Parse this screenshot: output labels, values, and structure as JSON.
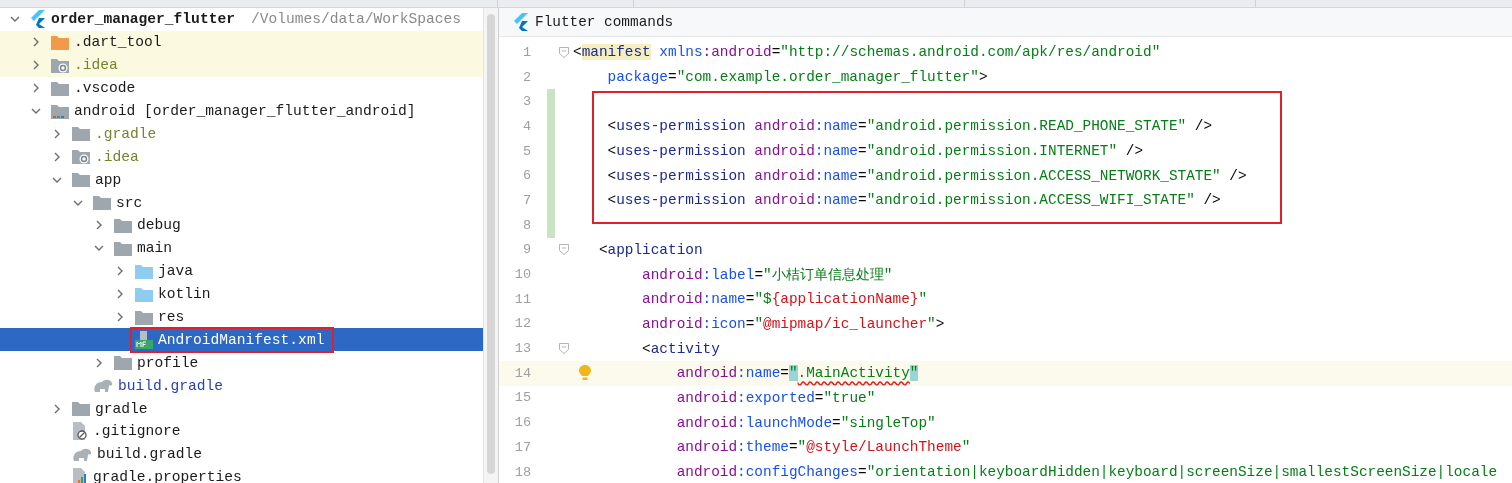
{
  "project_tree": {
    "items": [
      {
        "name": "order_manager_flutter",
        "detail": "/Volumes/data/WorkSpaces",
        "kind": "flutter",
        "expanded": true,
        "selected": false,
        "highlighted": false,
        "annotated": false,
        "ignored": false,
        "modified": false,
        "children": [
          {
            "name": ".dart_tool",
            "kind": "excluded-folder",
            "expanded": false,
            "selected": false,
            "highlighted": true,
            "annotated": false,
            "ignored": false,
            "modified": false
          },
          {
            "name": ".idea",
            "kind": "settings-folder",
            "expanded": false,
            "selected": false,
            "highlighted": true,
            "annotated": false,
            "ignored": true,
            "modified": false
          },
          {
            "name": ".vscode",
            "kind": "folder",
            "expanded": false,
            "selected": false,
            "highlighted": false,
            "annotated": false,
            "ignored": false,
            "modified": false
          },
          {
            "name": "android [order_manager_flutter_android]",
            "kind": "module",
            "expanded": true,
            "selected": false,
            "highlighted": false,
            "annotated": false,
            "ignored": false,
            "modified": false,
            "children": [
              {
                "name": ".gradle",
                "kind": "folder",
                "expanded": false,
                "selected": false,
                "highlighted": false,
                "annotated": false,
                "ignored": true,
                "modified": false
              },
              {
                "name": ".idea",
                "kind": "settings-folder",
                "expanded": false,
                "selected": false,
                "highlighted": false,
                "annotated": false,
                "ignored": true,
                "modified": false
              },
              {
                "name": "app",
                "kind": "folder",
                "expanded": true,
                "selected": false,
                "highlighted": false,
                "annotated": false,
                "ignored": false,
                "modified": false,
                "children": [
                  {
                    "name": "src",
                    "kind": "folder",
                    "expanded": true,
                    "selected": false,
                    "highlighted": false,
                    "annotated": false,
                    "ignored": false,
                    "modified": false,
                    "children": [
                      {
                        "name": "debug",
                        "kind": "folder",
                        "expanded": false,
                        "selected": false,
                        "highlighted": false,
                        "annotated": false,
                        "ignored": false,
                        "modified": false
                      },
                      {
                        "name": "main",
                        "kind": "folder",
                        "expanded": true,
                        "selected": false,
                        "highlighted": false,
                        "annotated": false,
                        "ignored": false,
                        "modified": false,
                        "children": [
                          {
                            "name": "java",
                            "kind": "source-folder",
                            "expanded": false,
                            "selected": false,
                            "highlighted": false,
                            "annotated": false,
                            "ignored": false,
                            "modified": false
                          },
                          {
                            "name": "kotlin",
                            "kind": "source-folder",
                            "expanded": false,
                            "selected": false,
                            "highlighted": false,
                            "annotated": false,
                            "ignored": false,
                            "modified": false
                          },
                          {
                            "name": "res",
                            "kind": "folder",
                            "expanded": false,
                            "selected": false,
                            "highlighted": false,
                            "annotated": false,
                            "ignored": false,
                            "modified": false
                          },
                          {
                            "name": "AndroidManifest.xml",
                            "kind": "manifest",
                            "selected": true,
                            "highlighted": false,
                            "annotated": true,
                            "ignored": false,
                            "modified": false
                          }
                        ]
                      },
                      {
                        "name": "profile",
                        "kind": "folder",
                        "expanded": false,
                        "selected": false,
                        "highlighted": false,
                        "annotated": false,
                        "ignored": false,
                        "modified": false
                      }
                    ]
                  },
                  {
                    "name": "build.gradle",
                    "kind": "gradle",
                    "selected": false,
                    "highlighted": false,
                    "annotated": false,
                    "ignored": false,
                    "modified": true
                  }
                ]
              },
              {
                "name": "gradle",
                "kind": "folder",
                "expanded": false,
                "selected": false,
                "highlighted": false,
                "annotated": false,
                "ignored": false,
                "modified": false
              },
              {
                "name": ".gitignore",
                "kind": "gitignore",
                "selected": false,
                "highlighted": false,
                "annotated": false,
                "ignored": false,
                "modified": false
              },
              {
                "name": "build.gradle",
                "kind": "gradle",
                "selected": false,
                "highlighted": false,
                "annotated": false,
                "ignored": false,
                "modified": false
              },
              {
                "name": "gradle.properties",
                "kind": "properties",
                "selected": false,
                "highlighted": false,
                "annotated": false,
                "ignored": false,
                "modified": false
              }
            ]
          }
        ]
      }
    ]
  },
  "editor": {
    "toolbar": {
      "label": "Flutter commands"
    },
    "lines": [
      {
        "number": "1",
        "changed": false,
        "fold": true,
        "current": false,
        "boxed": false,
        "bulb": false,
        "tokens": [
          {
            "kind": "punct",
            "text": "<"
          },
          {
            "kind": "tag-match",
            "text": "manifest"
          },
          {
            "kind": "attr",
            "text": " xmlns"
          },
          {
            "kind": "ns",
            "text": ":android"
          },
          {
            "kind": "punct",
            "text": "="
          },
          {
            "kind": "string",
            "text": "\"http://schemas.android.com/apk/res/android\""
          }
        ]
      },
      {
        "number": "2",
        "changed": false,
        "fold": false,
        "current": false,
        "boxed": false,
        "bulb": false,
        "tokens": [
          {
            "kind": "attr",
            "text": "    package"
          },
          {
            "kind": "punct",
            "text": "="
          },
          {
            "kind": "string",
            "text": "\"com.example.order_manager_flutter\""
          },
          {
            "kind": "punct",
            "text": ">"
          }
        ]
      },
      {
        "number": "3",
        "changed": true,
        "fold": false,
        "current": false,
        "boxed": true,
        "bulb": false
      },
      {
        "number": "4",
        "changed": true,
        "fold": false,
        "current": false,
        "boxed": true,
        "bulb": false,
        "tokens": [
          {
            "kind": "punct",
            "text": "    <"
          },
          {
            "kind": "tag",
            "text": "uses-permission"
          },
          {
            "kind": "ns",
            "text": " android"
          },
          {
            "kind": "attr",
            "text": ":name"
          },
          {
            "kind": "punct",
            "text": "="
          },
          {
            "kind": "string",
            "text": "\"android.permission.READ_PHONE_STATE\""
          },
          {
            "kind": "punct",
            "text": " />"
          }
        ]
      },
      {
        "number": "5",
        "changed": true,
        "fold": false,
        "current": false,
        "boxed": true,
        "bulb": false,
        "tokens": [
          {
            "kind": "punct",
            "text": "    <"
          },
          {
            "kind": "tag",
            "text": "uses-permission"
          },
          {
            "kind": "ns",
            "text": " android"
          },
          {
            "kind": "attr",
            "text": ":name"
          },
          {
            "kind": "punct",
            "text": "="
          },
          {
            "kind": "string",
            "text": "\"android.permission.INTERNET\""
          },
          {
            "kind": "punct",
            "text": " />"
          }
        ]
      },
      {
        "number": "6",
        "changed": true,
        "fold": false,
        "current": false,
        "boxed": true,
        "bulb": false,
        "tokens": [
          {
            "kind": "punct",
            "text": "    <"
          },
          {
            "kind": "tag",
            "text": "uses-permission"
          },
          {
            "kind": "ns",
            "text": " android"
          },
          {
            "kind": "attr",
            "text": ":name"
          },
          {
            "kind": "punct",
            "text": "="
          },
          {
            "kind": "string",
            "text": "\"android.permission.ACCESS_NETWORK_STATE\""
          },
          {
            "kind": "punct",
            "text": " />"
          }
        ]
      },
      {
        "number": "7",
        "changed": true,
        "fold": false,
        "current": false,
        "boxed": true,
        "bulb": false,
        "tokens": [
          {
            "kind": "punct",
            "text": "    <"
          },
          {
            "kind": "tag",
            "text": "uses-permission"
          },
          {
            "kind": "ns",
            "text": " android"
          },
          {
            "kind": "attr",
            "text": ":name"
          },
          {
            "kind": "punct",
            "text": "="
          },
          {
            "kind": "string",
            "text": "\"android.permission.ACCESS_WIFI_STATE\""
          },
          {
            "kind": "punct",
            "text": " />"
          }
        ]
      },
      {
        "number": "8",
        "changed": true,
        "fold": false,
        "current": false,
        "boxed": false,
        "bulb": false
      },
      {
        "number": "9",
        "changed": false,
        "fold": true,
        "current": false,
        "boxed": false,
        "bulb": false,
        "tokens": [
          {
            "kind": "punct",
            "text": "   <"
          },
          {
            "kind": "tag",
            "text": "application"
          }
        ]
      },
      {
        "number": "10",
        "changed": false,
        "fold": false,
        "current": false,
        "boxed": false,
        "bulb": false,
        "tokens": [
          {
            "kind": "ns",
            "text": "        android"
          },
          {
            "kind": "attr",
            "text": ":label"
          },
          {
            "kind": "punct",
            "text": "="
          },
          {
            "kind": "string",
            "text": "\"小桔订单信息处理\""
          }
        ]
      },
      {
        "number": "11",
        "changed": false,
        "fold": false,
        "current": false,
        "boxed": false,
        "bulb": false,
        "tokens": [
          {
            "kind": "ns",
            "text": "        android"
          },
          {
            "kind": "attr",
            "text": ":name"
          },
          {
            "kind": "punct",
            "text": "="
          },
          {
            "kind": "string",
            "text": "\"$"
          },
          {
            "kind": "ref",
            "text": "{applicationName}"
          },
          {
            "kind": "string",
            "text": "\""
          }
        ]
      },
      {
        "number": "12",
        "changed": false,
        "fold": false,
        "current": false,
        "boxed": false,
        "bulb": false,
        "tokens": [
          {
            "kind": "ns",
            "text": "        android"
          },
          {
            "kind": "attr",
            "text": ":icon"
          },
          {
            "kind": "punct",
            "text": "="
          },
          {
            "kind": "string",
            "text": "\""
          },
          {
            "kind": "ref",
            "text": "@mipmap/ic_launcher"
          },
          {
            "kind": "string",
            "text": "\""
          },
          {
            "kind": "punct",
            "text": ">"
          }
        ]
      },
      {
        "number": "13",
        "changed": false,
        "fold": true,
        "current": false,
        "boxed": false,
        "bulb": false,
        "tokens": [
          {
            "kind": "punct",
            "text": "        <"
          },
          {
            "kind": "tag",
            "text": "activity"
          }
        ]
      },
      {
        "number": "14",
        "changed": false,
        "fold": false,
        "current": true,
        "boxed": false,
        "bulb": true,
        "tokens": [
          {
            "kind": "ns",
            "text": "            android"
          },
          {
            "kind": "attr",
            "text": ":name"
          },
          {
            "kind": "punct",
            "text": "="
          },
          {
            "kind": "string-match",
            "text": "\""
          },
          {
            "kind": "error",
            "text": ".MainActivity"
          },
          {
            "kind": "string-match",
            "text": "\""
          }
        ]
      },
      {
        "number": "15",
        "changed": false,
        "fold": false,
        "current": false,
        "boxed": false,
        "bulb": false,
        "tokens": [
          {
            "kind": "ns",
            "text": "            android"
          },
          {
            "kind": "attr",
            "text": ":exported"
          },
          {
            "kind": "punct",
            "text": "="
          },
          {
            "kind": "string",
            "text": "\"true\""
          }
        ]
      },
      {
        "number": "16",
        "changed": false,
        "fold": false,
        "current": false,
        "boxed": false,
        "bulb": false,
        "tokens": [
          {
            "kind": "ns",
            "text": "            android"
          },
          {
            "kind": "attr",
            "text": ":launchMode"
          },
          {
            "kind": "punct",
            "text": "="
          },
          {
            "kind": "string",
            "text": "\"singleTop\""
          }
        ]
      },
      {
        "number": "17",
        "changed": false,
        "fold": false,
        "current": false,
        "boxed": false,
        "bulb": false,
        "tokens": [
          {
            "kind": "ns",
            "text": "            android"
          },
          {
            "kind": "attr",
            "text": ":theme"
          },
          {
            "kind": "punct",
            "text": "="
          },
          {
            "kind": "string",
            "text": "\""
          },
          {
            "kind": "ref",
            "text": "@style/LaunchTheme"
          },
          {
            "kind": "string",
            "text": "\""
          }
        ]
      },
      {
        "number": "18",
        "changed": false,
        "fold": false,
        "current": false,
        "boxed": false,
        "bulb": false,
        "tokens": [
          {
            "kind": "ns",
            "text": "            android"
          },
          {
            "kind": "attr",
            "text": ":configChanges"
          },
          {
            "kind": "punct",
            "text": "="
          },
          {
            "kind": "string",
            "text": "\"orientation|keyboardHidden|keyboard|screenSize|smallestScreenSize|locale"
          }
        ]
      }
    ]
  }
}
